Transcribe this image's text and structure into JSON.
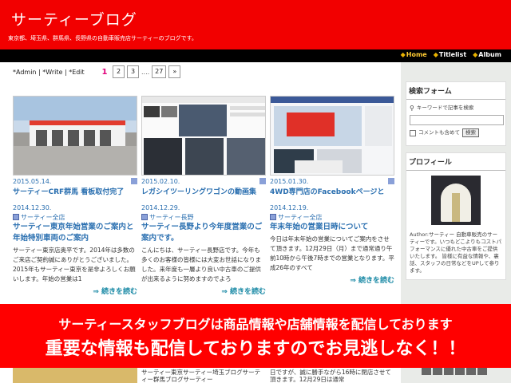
{
  "header": {
    "title": "サーティーブログ",
    "description": "東京都、埼玉県、群馬県、長野県の自動車販売店サーティーのブログです。"
  },
  "nav": [
    {
      "label": "Home",
      "active": true
    },
    {
      "label": "Titlelist",
      "active": false
    },
    {
      "label": "Album",
      "active": false
    }
  ],
  "toolbar": {
    "admin": "*Admin",
    "write": "*Write",
    "edit": "*Edit"
  },
  "pager": {
    "current": "1",
    "pages": [
      "2",
      "3"
    ],
    "dots": "....",
    "last": "27",
    "next": "»"
  },
  "cards": [
    {
      "date": "2015.05.14.",
      "title": "サーティーCRF群馬 看板取付完了"
    },
    {
      "date": "2015.02.10.",
      "title": "レガシイツーリングワゴンの動画集"
    },
    {
      "date": "2015.01.30.",
      "title": "4WD専門店のFacebookページと"
    }
  ],
  "posts": [
    {
      "date": "2014.12.30.",
      "category": "サーティー全店",
      "title": "サーティー東京年始営業のご案内と年始特別車両のご案内",
      "body": "サーティー東京店奥平です。2014年は多数のご来店ご契約誠にありがとうございました。2015年もサーティー東京を是非よろしくお願いします。年始の営業は1",
      "more": "⇒ 続きを読む"
    },
    {
      "date": "2014.12.29.",
      "category": "サーティー長野",
      "title": "サーティー長野より今年度営業のご案内です。",
      "body": "こんにちは、サーティー長野店です。今年も多くのお客様の皆様には大変お世話になりました。来年度も一層より良い中古車のご提供が出来るように努めますのでよろ",
      "more": "⇒ 続きを読む"
    },
    {
      "date": "2014.12.19.",
      "category": "サーティー全店",
      "title": "年末年始の営業日時について",
      "body": "今日は年末年始の営業についてご案内をさせて頂きます。12月29日（月）まで通常通り午前10時から午後7時までの営業となります。平成26年のすべて",
      "more": "⇒ 続きを読む"
    }
  ],
  "sidebar": {
    "search": {
      "heading": "検索フォーム",
      "keyword_label": "キーワードで記事を検索",
      "comment_label": "コメントも含めて",
      "button": "検索"
    },
    "profile": {
      "heading": "プロフィール",
      "text": "Author:サーティー 自動車販売のサーティーです。いつもどこよりもコストパフォーマンスに優れた中古車をご提供いたします。 皆様に有益な情報や、裏話、スタッフの日常などをUPして参ります。"
    }
  },
  "banner": {
    "line1": "サーティースタッフブログは商品情報や店舗情報を配信しております",
    "line2": "重要な情報も配信しておりますのでお見逃しなく！！"
  },
  "strip": {
    "col2": "サーティー東京サーティー埼玉ブログサーティー群馬ブログサーティー",
    "col3": "日ですが、誠に勝手ながら16時に閉店させて頂きます。12月29日は通常"
  },
  "colors": {
    "header": "#f20000",
    "nav": "#000000",
    "link": "#2a6fb0",
    "banner": "#ff0000"
  }
}
